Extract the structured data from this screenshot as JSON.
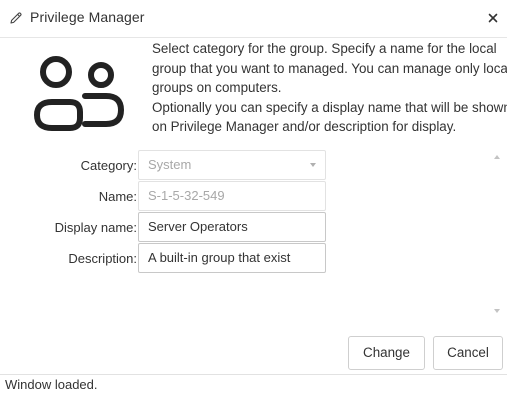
{
  "window": {
    "title": "Privilege Manager",
    "title_icon": "pencil-icon",
    "close_icon": "close-icon"
  },
  "header": {
    "icon": "user-group-icon",
    "description": [
      "Select category for the group. Specify a name for the local group that you want to managed. You can manage only local groups on computers.",
      "Optionally you can specify a display name that will be shown on Privilege Manager and/or description for display."
    ]
  },
  "form": {
    "category": {
      "label": "Category:",
      "value": "System"
    },
    "name": {
      "label": "Name:",
      "value": "S-1-5-32-549"
    },
    "display_name": {
      "label": "Display name:",
      "value": "Server Operators"
    },
    "description": {
      "label": "Description:",
      "value": "A built-in group that exist"
    }
  },
  "buttons": {
    "change": "Change",
    "cancel": "Cancel"
  },
  "status": {
    "text": "Window loaded."
  }
}
